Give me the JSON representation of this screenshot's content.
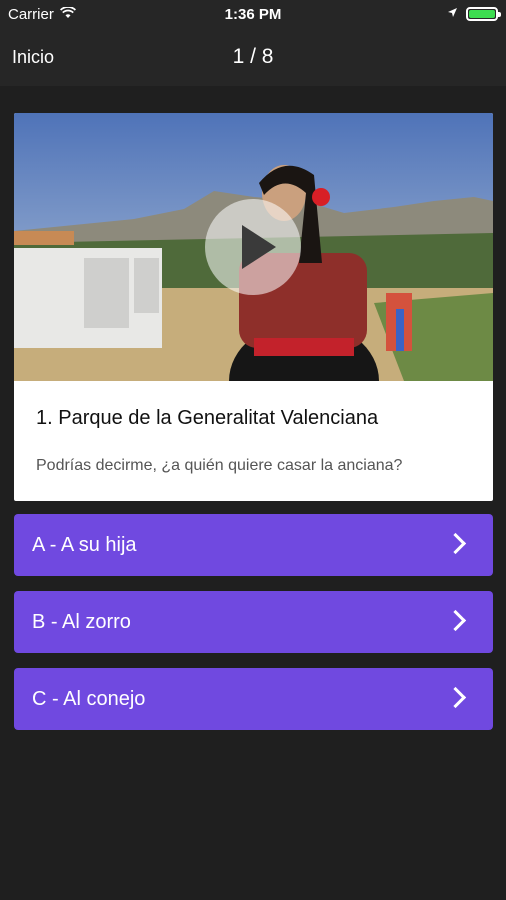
{
  "status_bar": {
    "carrier": "Carrier",
    "time": "1:36 PM"
  },
  "nav": {
    "back_label": "Inicio",
    "progress": "1 / 8"
  },
  "card": {
    "place_title": "1. Parque de la Generalitat Valenciana",
    "question": "Podrías decirme, ¿a quién quiere casar la anciana?"
  },
  "answers": [
    {
      "label": "A - A su hija"
    },
    {
      "label": "B - Al zorro"
    },
    {
      "label": "C - Al conejo"
    }
  ],
  "colors": {
    "background": "#1f1f1f",
    "bar": "#262626",
    "answer_button": "#7049e0",
    "battery": "#3ddc50"
  }
}
